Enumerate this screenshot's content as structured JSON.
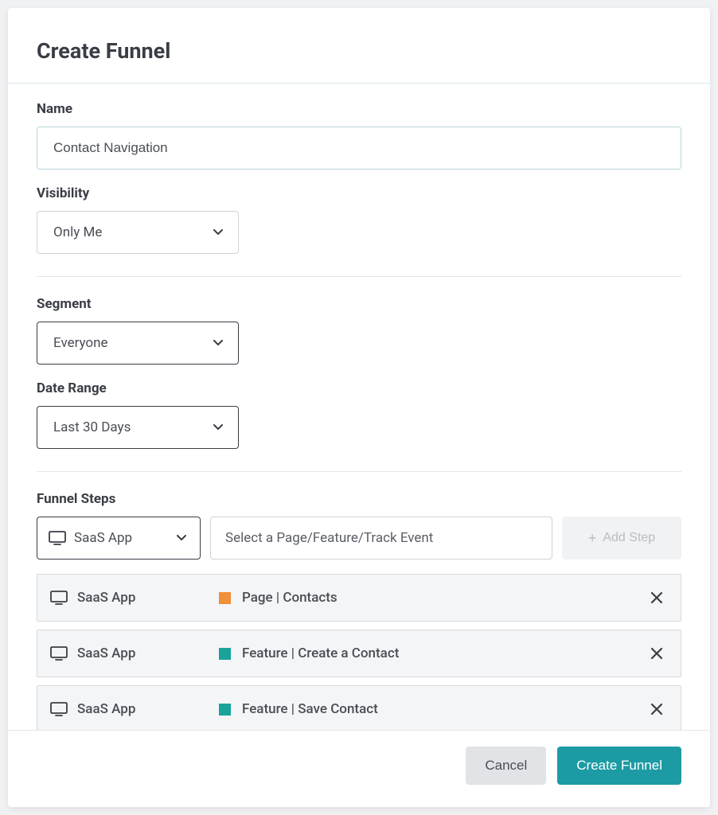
{
  "header": {
    "title": "Create Funnel"
  },
  "fields": {
    "name_label": "Name",
    "name_value": "Contact Navigation",
    "visibility_label": "Visibility",
    "visibility_value": "Only Me",
    "segment_label": "Segment",
    "segment_value": "Everyone",
    "date_range_label": "Date Range",
    "date_range_value": "Last 30 Days"
  },
  "funnel": {
    "section_label": "Funnel Steps",
    "app_select_value": "SaaS App",
    "event_placeholder": "Select a Page/Feature/Track Event",
    "add_step_label": "Add Step",
    "steps": [
      {
        "app": "SaaS App",
        "color": "#f09038",
        "label": "Page | Contacts"
      },
      {
        "app": "SaaS App",
        "color": "#1aa39a",
        "label": "Feature | Create a Contact"
      },
      {
        "app": "SaaS App",
        "color": "#1aa39a",
        "label": "Feature | Save Contact"
      }
    ]
  },
  "footer": {
    "cancel_label": "Cancel",
    "submit_label": "Create Funnel"
  }
}
